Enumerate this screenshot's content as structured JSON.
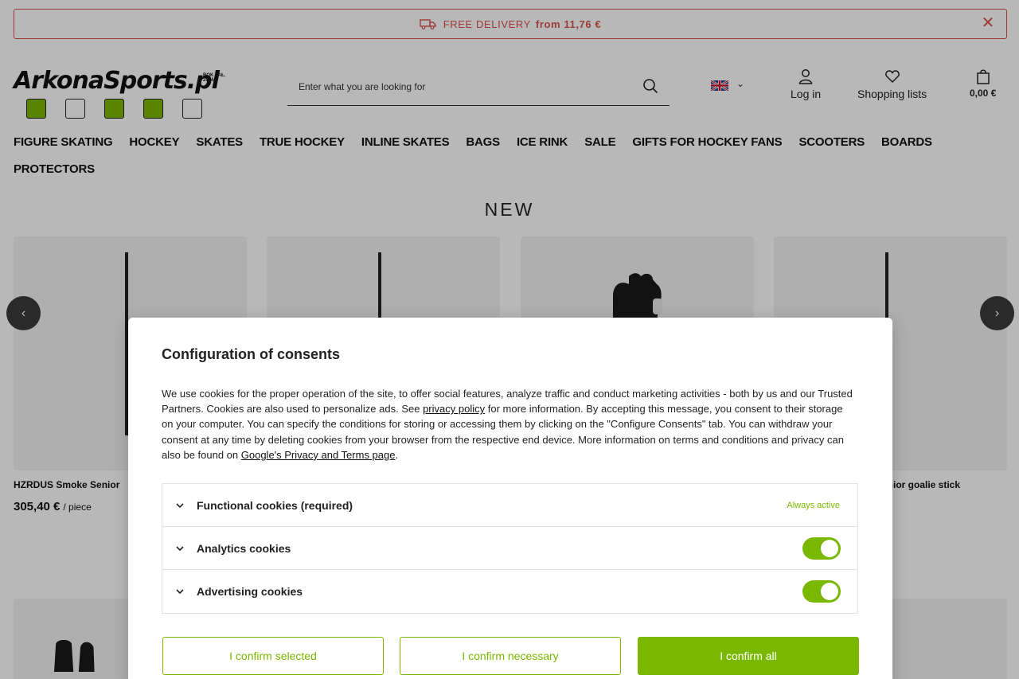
{
  "promo": {
    "text": "FREE DELIVERY",
    "bold": "from 11,76 €",
    "close": "✕"
  },
  "logo": {
    "text": "ArkonaSports.pl",
    "since": "ROK ZAŁ. 2004"
  },
  "search": {
    "placeholder": "Enter what you are looking for"
  },
  "lang": {
    "chevron": "⌄"
  },
  "header": {
    "login": "Log in",
    "lists": "Shopping lists",
    "cart": "0,00 €"
  },
  "nav": [
    "FIGURE SKATING",
    "HOCKEY",
    "SKATES",
    "TRUE HOCKEY",
    "INLINE SKATES",
    "BAGS",
    "ICE RINK",
    "SALE",
    "GIFTS FOR HOCKEY FANS",
    "SCOOTERS",
    "BOARDS",
    "PROTECTORS"
  ],
  "section": {
    "title": "NEW",
    "arrow_left": "‹",
    "arrow_right": "›"
  },
  "products": {
    "p1_title": "HZRDUS Smoke Senior",
    "p1_price": "305,40 €",
    "p1_unit": "/ piece",
    "p4_title": "enior goalie stick"
  },
  "modal": {
    "title": "Configuration of consents",
    "desc_1": "We use cookies for the proper operation of the site, to offer social features, analyze traffic and conduct marketing activities - both by us and our Trusted Partners. Cookies are also used to personalize ads. See ",
    "privacy_link": "privacy policy",
    "desc_2": " for more information. By accepting this message, you consent to their storage on your computer. You can specify the conditions for storing or accessing them by clicking on the \"Configure Consents\" tab. You can withdraw your consent at any time by deleting cookies from your browser from the respective end device. More information on terms and conditions and privacy can also be found on ",
    "google_link": "Google's Privacy and Terms page",
    "desc_3": ".",
    "consents": [
      {
        "label": "Functional cookies (required)",
        "status": "Always active"
      },
      {
        "label": "Analytics cookies",
        "enabled": true
      },
      {
        "label": "Advertising cookies",
        "enabled": true
      }
    ],
    "btn_selected": "I confirm selected",
    "btn_necessary": "I confirm necessary",
    "btn_all": "I confirm all"
  },
  "colors": {
    "accent": "#7ab800",
    "promo": "#d9534f"
  }
}
